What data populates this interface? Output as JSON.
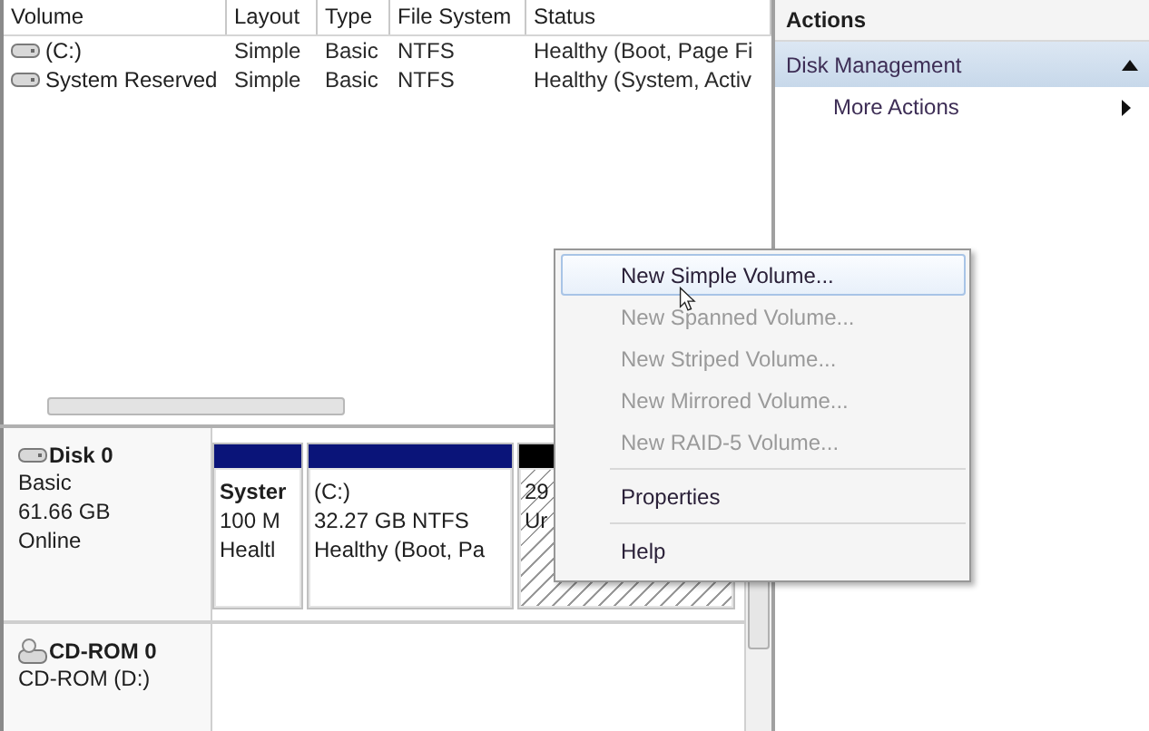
{
  "volume_table": {
    "columns": [
      "Volume",
      "Layout",
      "Type",
      "File System",
      "Status"
    ],
    "rows": [
      {
        "cells": [
          "(C:)",
          "Simple",
          "Basic",
          "NTFS",
          "Healthy (Boot, Page Fi"
        ]
      },
      {
        "cells": [
          "System Reserved",
          "Simple",
          "Basic",
          "NTFS",
          "Healthy (System, Activ"
        ]
      }
    ]
  },
  "disks": [
    {
      "kind": "disk",
      "name": "Disk 0",
      "lines": [
        "Basic",
        "61.66 GB",
        "Online"
      ],
      "partitions": [
        {
          "kind": "primary",
          "lines": [
            "Syster",
            "100 M",
            "Healtl"
          ]
        },
        {
          "kind": "primary",
          "lines": [
            "(C:)",
            "32.27 GB NTFS",
            "Healthy (Boot, Pa"
          ]
        },
        {
          "kind": "unallocated",
          "lines": [
            "29",
            "Ur"
          ]
        }
      ]
    },
    {
      "kind": "cdrom",
      "name": "CD-ROM 0",
      "lines": [
        "CD-ROM (D:)"
      ]
    }
  ],
  "actions": {
    "title": "Actions",
    "section": {
      "label": "Disk Management",
      "expanded": true
    },
    "items": [
      {
        "label": "More Actions"
      }
    ]
  },
  "context_menu": {
    "groups": [
      [
        {
          "label": "New Simple Volume...",
          "disabled": false,
          "selected": true
        },
        {
          "label": "New Spanned Volume...",
          "disabled": true,
          "selected": false
        },
        {
          "label": "New Striped Volume...",
          "disabled": true,
          "selected": false
        },
        {
          "label": "New Mirrored Volume...",
          "disabled": true,
          "selected": false
        },
        {
          "label": "New RAID-5 Volume...",
          "disabled": true,
          "selected": false
        }
      ],
      [
        {
          "label": "Properties",
          "disabled": false,
          "selected": false
        }
      ],
      [
        {
          "label": "Help",
          "disabled": false,
          "selected": false
        }
      ]
    ]
  }
}
